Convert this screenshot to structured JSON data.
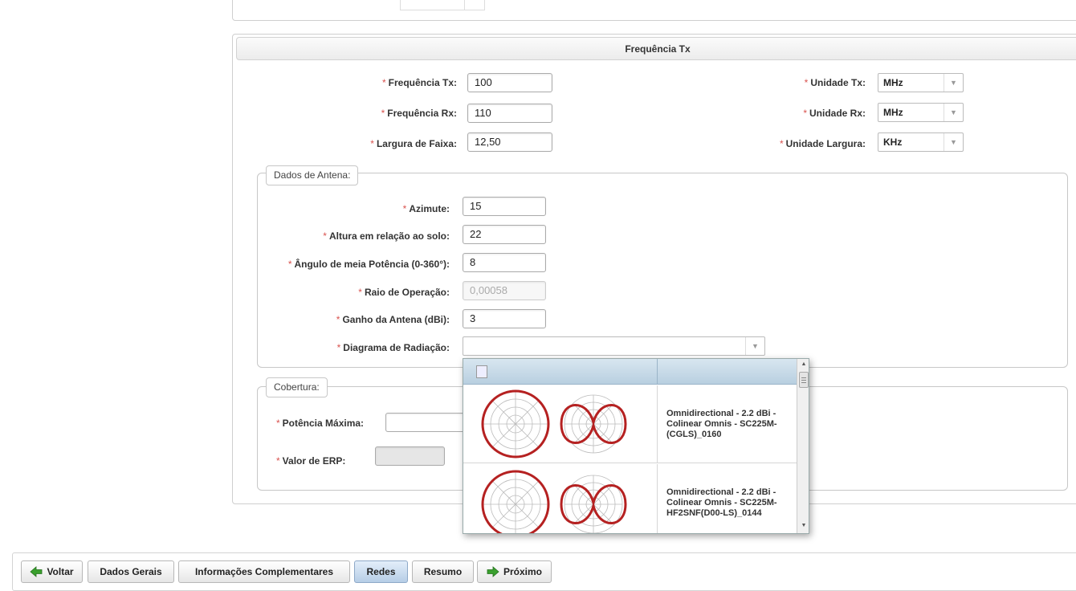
{
  "panel": {
    "title": "Frequência Tx"
  },
  "freq_fields": [
    {
      "label": "Frequência Tx:",
      "value": "100"
    },
    {
      "label": "Frequência Rx:",
      "value": "110"
    },
    {
      "label": "Largura de Faixa:",
      "value": "12,50"
    }
  ],
  "unit_fields": [
    {
      "label": "Unidade Tx:",
      "value": "MHz"
    },
    {
      "label": "Unidade Rx:",
      "value": "MHz"
    },
    {
      "label": "Unidade Largura:",
      "value": "KHz"
    }
  ],
  "antena": {
    "legend": "Dados de Antena:",
    "fields": [
      {
        "label": "Azimute:",
        "value": "15"
      },
      {
        "label": "Altura em relação ao solo:",
        "value": "22"
      },
      {
        "label": "Ângulo de meia Potência (0-360°):",
        "value": "8"
      },
      {
        "label": "Raio de Operação:",
        "value": "0,00058"
      },
      {
        "label": "Ganho da Antena (dBi):",
        "value": "3"
      }
    ],
    "diagram_label": "Diagrama de Radiação:",
    "diagram_value": ""
  },
  "cobertura": {
    "legend": "Cobertura:",
    "potencia_label": "Potência Máxima:",
    "potencia_value": "",
    "erp_label": "Valor de ERP:",
    "erp_value": ""
  },
  "required_mark": "*",
  "diagram_options": [
    {
      "text": "Omnidirectional - 2.2 dBi - Colinear Omnis - SC225M-(CGLS)_0160"
    },
    {
      "text": "Omnidirectional - 2.2 dBi - Colinear Omnis - SC225M-HF2SNF(D00-LS)_0144"
    }
  ],
  "nav": {
    "back": "Voltar",
    "tabs": [
      "Dados Gerais",
      "Informações Complementares",
      "Redes",
      "Resumo"
    ],
    "next": "Próximo",
    "active_tab": "Redes"
  },
  "colors": {
    "required": "#d9534f",
    "pattern": "#b52121",
    "arrow": "#3aa02e"
  },
  "icons": [
    "arrow-left-icon",
    "arrow-right-icon",
    "chevron-down-icon",
    "broken-image-icon",
    "polar-pattern-icon"
  ]
}
